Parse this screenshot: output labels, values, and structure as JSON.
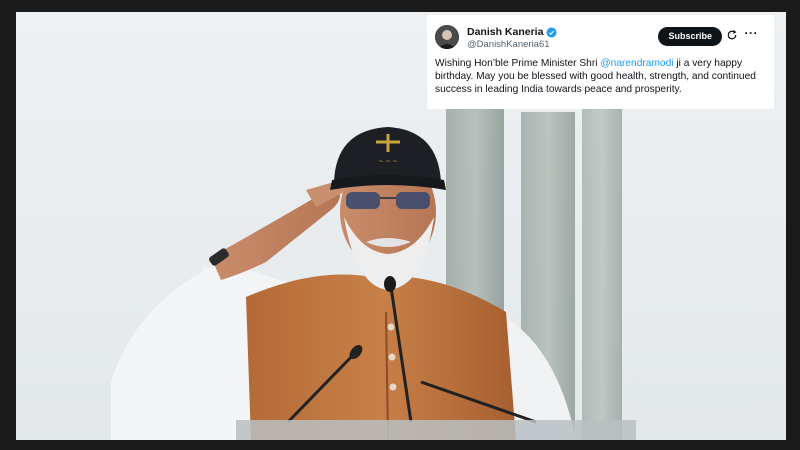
{
  "tweet": {
    "display_name": "Danish Kaneria",
    "handle": "@DanishKaneria61",
    "subscribe_label": "Subscribe",
    "text_before": "Wishing Hon’ble Prime Minister Shri ",
    "mention": "@narendramodi",
    "text_after": " ji a very happy birthday. May you be blessed with good health, strength, and continued success in leading India towards peace and prosperity.",
    "verified_color": "#1d9bf0",
    "icons": [
      "verified-badge-icon",
      "refresh-icon",
      "more-icon"
    ]
  }
}
